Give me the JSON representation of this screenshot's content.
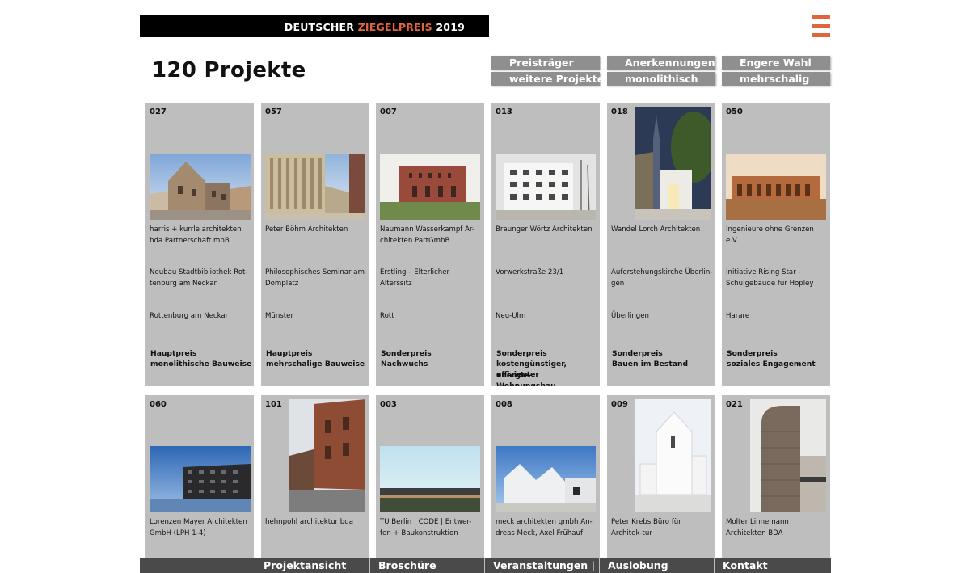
{
  "header": {
    "logo_part1": "DEUTSCHER ",
    "logo_part2": "ZIEGELPREIS",
    "logo_part3": " 2019",
    "menu_icon": "hamburger-menu-icon",
    "accent_color": "#e0653a"
  },
  "page_title": "120 Projekte",
  "filters": [
    {
      "label": "Preisträger"
    },
    {
      "label": "weitere Projekte"
    },
    {
      "label": "Anerkennungen"
    },
    {
      "label": "monolithisch"
    },
    {
      "label": "Engere Wahl"
    },
    {
      "label": "mehrschalig"
    }
  ],
  "projects": [
    {
      "number": "027",
      "architect": "harris + kurrle architekten bda Partnerschaft mbB",
      "project": "Neubau Stadtbibliothek Rot-tenburg am Neckar",
      "city": "Rottenburg am Neckar",
      "award_line1": "Hauptpreis",
      "award_line2": "monolithische Bauweise",
      "award_line3": ""
    },
    {
      "number": "057",
      "architect": "Peter Böhm Architekten",
      "project": "Philosophisches Seminar am Domplatz",
      "city": "Münster",
      "award_line1": "Hauptpreis",
      "award_line2": "mehrschalige Bauweise",
      "award_line3": ""
    },
    {
      "number": "007",
      "architect": "Naumann Wasserkampf Ar-chitekten PartGmbB",
      "project": "Erstling – Elterlicher Alterssitz",
      "city": "Rott",
      "award_line1": "Sonderpreis",
      "award_line2": "Nachwuchs",
      "award_line3": ""
    },
    {
      "number": "013",
      "architect": "Braunger Wörtz Architekten",
      "project": "Vorwerkstraße 23/1",
      "city": "Neu-Ulm",
      "award_line1": "Sonderpreis",
      "award_line2": "kostengünstiger, energie-",
      "award_line3": "effizienter Wohnungsbau"
    },
    {
      "number": "018",
      "architect": "Wandel Lorch Architekten",
      "project": "Auferstehungskirche Überlin-gen",
      "city": "Überlingen",
      "award_line1": "Sonderpreis",
      "award_line2": "Bauen im Bestand",
      "award_line3": ""
    },
    {
      "number": "050",
      "architect": "Ingenieure ohne Grenzen e.V.",
      "project": "Initiative Rising Star - Schulgebäude für Hopley",
      "city": "Harare",
      "award_line1": "Sonderpreis",
      "award_line2": "soziales Engagement",
      "award_line3": ""
    },
    {
      "number": "060",
      "architect": "Lorenzen Mayer Architekten GmbH (LPH 1-4)",
      "project": "",
      "city": "",
      "award_line1": "",
      "award_line2": "",
      "award_line3": ""
    },
    {
      "number": "101",
      "architect": "hehnpohl architektur bda",
      "project": "",
      "city": "",
      "award_line1": "",
      "award_line2": "",
      "award_line3": ""
    },
    {
      "number": "003",
      "architect": "TU Berlin | CODE | Entwer-fen + Baukonstruktion",
      "project": "",
      "city": "",
      "award_line1": "",
      "award_line2": "",
      "award_line3": ""
    },
    {
      "number": "008",
      "architect": "meck architekten gmbh An-dreas Meck, Axel Frühauf",
      "project": "",
      "city": "",
      "award_line1": "",
      "award_line2": "",
      "award_line3": ""
    },
    {
      "number": "009",
      "architect": "Peter Krebs Büro für Architek-tur",
      "project": "",
      "city": "",
      "award_line1": "",
      "award_line2": "",
      "award_line3": ""
    },
    {
      "number": "021",
      "architect": "Molter Linnemann Architekten BDA",
      "project": "",
      "city": "",
      "award_line1": "",
      "award_line2": "",
      "award_line3": ""
    }
  ],
  "bottom_nav": [
    {
      "label": ""
    },
    {
      "label": "Projektansicht"
    },
    {
      "label": "Broschüre"
    },
    {
      "label": "Veranstaltungen | PR"
    },
    {
      "label": "Auslobung"
    },
    {
      "label": "Kontakt"
    }
  ]
}
